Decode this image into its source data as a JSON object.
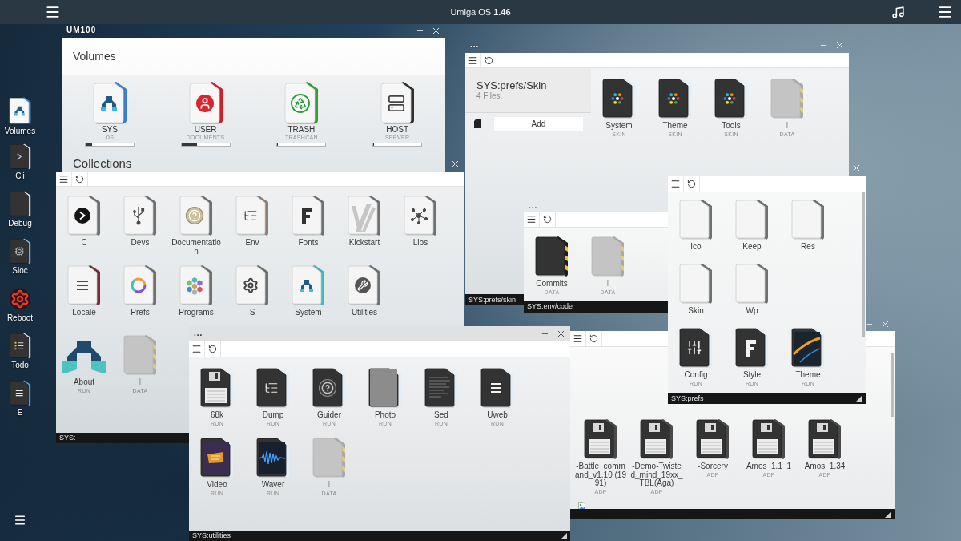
{
  "menu_bar": {
    "title": "Umiga OS **1.46**"
  },
  "dock": [
    {
      "label": "Volumes"
    },
    {
      "label": "Cli"
    },
    {
      "label": "Debug"
    },
    {
      "label": "Sloc"
    },
    {
      "label": "Reboot"
    },
    {
      "label": "Todo"
    },
    {
      "label": "E"
    }
  ],
  "windows": [
    {
      "title": "UM100",
      "active": false,
      "heading": "Volumes",
      "volumes": [
        {
          "name": "SYS",
          "type": "OS",
          "level": 0.14
        },
        {
          "name": "USER",
          "type": "DOCUMENTS",
          "level": 0.32
        },
        {
          "name": "TRASH",
          "type": "TRASHCAN",
          "level": 0
        },
        {
          "name": "HOST",
          "type": "SERVER",
          "level": 0
        }
      ],
      "next_heading": "Collections"
    },
    {
      "active": false,
      "drawers": [
        {
          "name": "C"
        },
        {
          "name": "Devs"
        },
        {
          "name": "Documentation"
        },
        {
          "name": "Env"
        },
        {
          "name": "Fonts"
        },
        {
          "name": "Kickstart"
        },
        {
          "name": "Libs"
        },
        {
          "name": "Locale"
        },
        {
          "name": "Prefs"
        },
        {
          "name": "Programs"
        },
        {
          "name": "S"
        },
        {
          "name": "System"
        },
        {
          "name": "Utilities"
        }
      ],
      "files": [
        {
          "name": "About",
          "type": "RUN",
          "kind": "logo"
        },
        {
          "name": "I",
          "type": "DATA",
          "kind": "ghost"
        }
      ],
      "path": "SYS:"
    },
    {
      "title": "...",
      "active": false,
      "location": "SYS:prefs/Skin",
      "count": "4 Files.",
      "add_button": "Add",
      "files": [
        {
          "name": "System",
          "type": "SKIN",
          "kind": "tool"
        },
        {
          "name": "Theme",
          "type": "SKIN",
          "kind": "tool"
        },
        {
          "name": "Tools",
          "type": "SKIN",
          "kind": "tool"
        },
        {
          "name": "I",
          "type": "DATA",
          "kind": "ghost"
        }
      ],
      "path": "SYS:prefs/skin"
    },
    {
      "title": "...",
      "active": false,
      "files": [
        {
          "name": "Commits",
          "type": "DATA",
          "kind": "data"
        },
        {
          "name": "I",
          "type": "DATA",
          "kind": "ghost"
        }
      ],
      "path": "SYS:env/code"
    },
    {
      "active": false,
      "drawers": [
        {
          "name": "Ico"
        },
        {
          "name": "Keep"
        },
        {
          "name": "Res"
        },
        {
          "name": "Skin"
        },
        {
          "name": "Wp"
        }
      ],
      "files": [
        {
          "name": "Config",
          "type": "RUN",
          "kind": "tool"
        },
        {
          "name": "Style",
          "type": "RUN",
          "kind": "tool"
        },
        {
          "name": "Theme",
          "type": "RUN",
          "kind": "tool"
        }
      ],
      "path": "SYS:prefs"
    },
    {
      "active": false,
      "files": [
        {
          "name": "-Battle_command_v1.10 (1991)",
          "type": "ADF",
          "kind": "disk"
        },
        {
          "name": "-Demo-Twisted_mind_19xx_TBL(Aga)",
          "type": "ADF",
          "kind": "disk"
        },
        {
          "name": "-Sorcery",
          "type": "ADF",
          "kind": "disk"
        },
        {
          "name": "Amos_1.1_1",
          "type": "ADF",
          "kind": "disk"
        },
        {
          "name": "Amos_1.34",
          "type": "ADF",
          "kind": "disk"
        }
      ]
    },
    {
      "title": "...",
      "active": true,
      "files": [
        {
          "name": "68k",
          "type": "RUN",
          "kind": "tool"
        },
        {
          "name": "Dump",
          "type": "RUN",
          "kind": "tool"
        },
        {
          "name": "Guider",
          "type": "RUN",
          "kind": "tool"
        },
        {
          "name": "Photo",
          "type": "RUN",
          "kind": "tool"
        },
        {
          "name": "Sed",
          "type": "RUN",
          "kind": "tool"
        },
        {
          "name": "Uweb",
          "type": "RUN",
          "kind": "tool"
        },
        {
          "name": "Video",
          "type": "RUN",
          "kind": "tool"
        },
        {
          "name": "Waver",
          "type": "RUN",
          "kind": "tool"
        },
        {
          "name": "I",
          "type": "DATA",
          "kind": "ghost"
        }
      ],
      "path": "SYS:utilities"
    }
  ]
}
